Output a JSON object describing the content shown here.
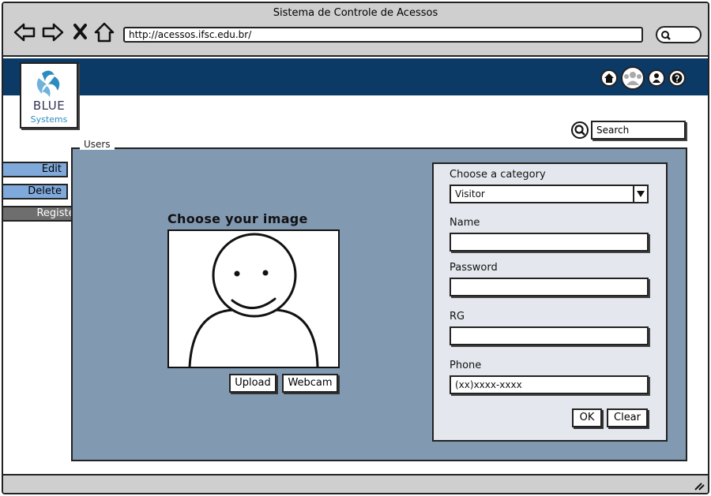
{
  "browser": {
    "title": "Sistema de Controle de Acessos",
    "url": "http://acessos.ifsc.edu.br/",
    "nav_icons": [
      "back-arrow-icon",
      "forward-arrow-icon",
      "close-icon",
      "home-icon"
    ]
  },
  "header": {
    "icons": [
      "home-icon",
      "users-icon",
      "user-icon",
      "help-icon"
    ]
  },
  "logo": {
    "name": "BLUE",
    "subtitle": "Systems"
  },
  "search": {
    "placeholder": "Search"
  },
  "sidebar": {
    "items": [
      {
        "label": "Edit",
        "active": false
      },
      {
        "label": "Delete",
        "active": false
      },
      {
        "label": "Register",
        "active": true
      }
    ]
  },
  "panel": {
    "legend": "Users"
  },
  "image_section": {
    "title": "Choose your image",
    "upload_label": "Upload",
    "webcam_label": "Webcam"
  },
  "form": {
    "category_label": "Choose a category",
    "category_value": "Visitor",
    "name_label": "Name",
    "name_value": "",
    "password_label": "Password",
    "password_value": "",
    "rg_label": "RG",
    "rg_value": "",
    "phone_label": "Phone",
    "phone_value": "(xx)xxxx-xxxx",
    "ok_label": "OK",
    "clear_label": "Clear"
  },
  "colors": {
    "header_bg": "#0b3a66",
    "panel_bg": "#8299b2",
    "sidebar_button": "#7fa9da",
    "sidebar_active": "#6e6e6e"
  }
}
